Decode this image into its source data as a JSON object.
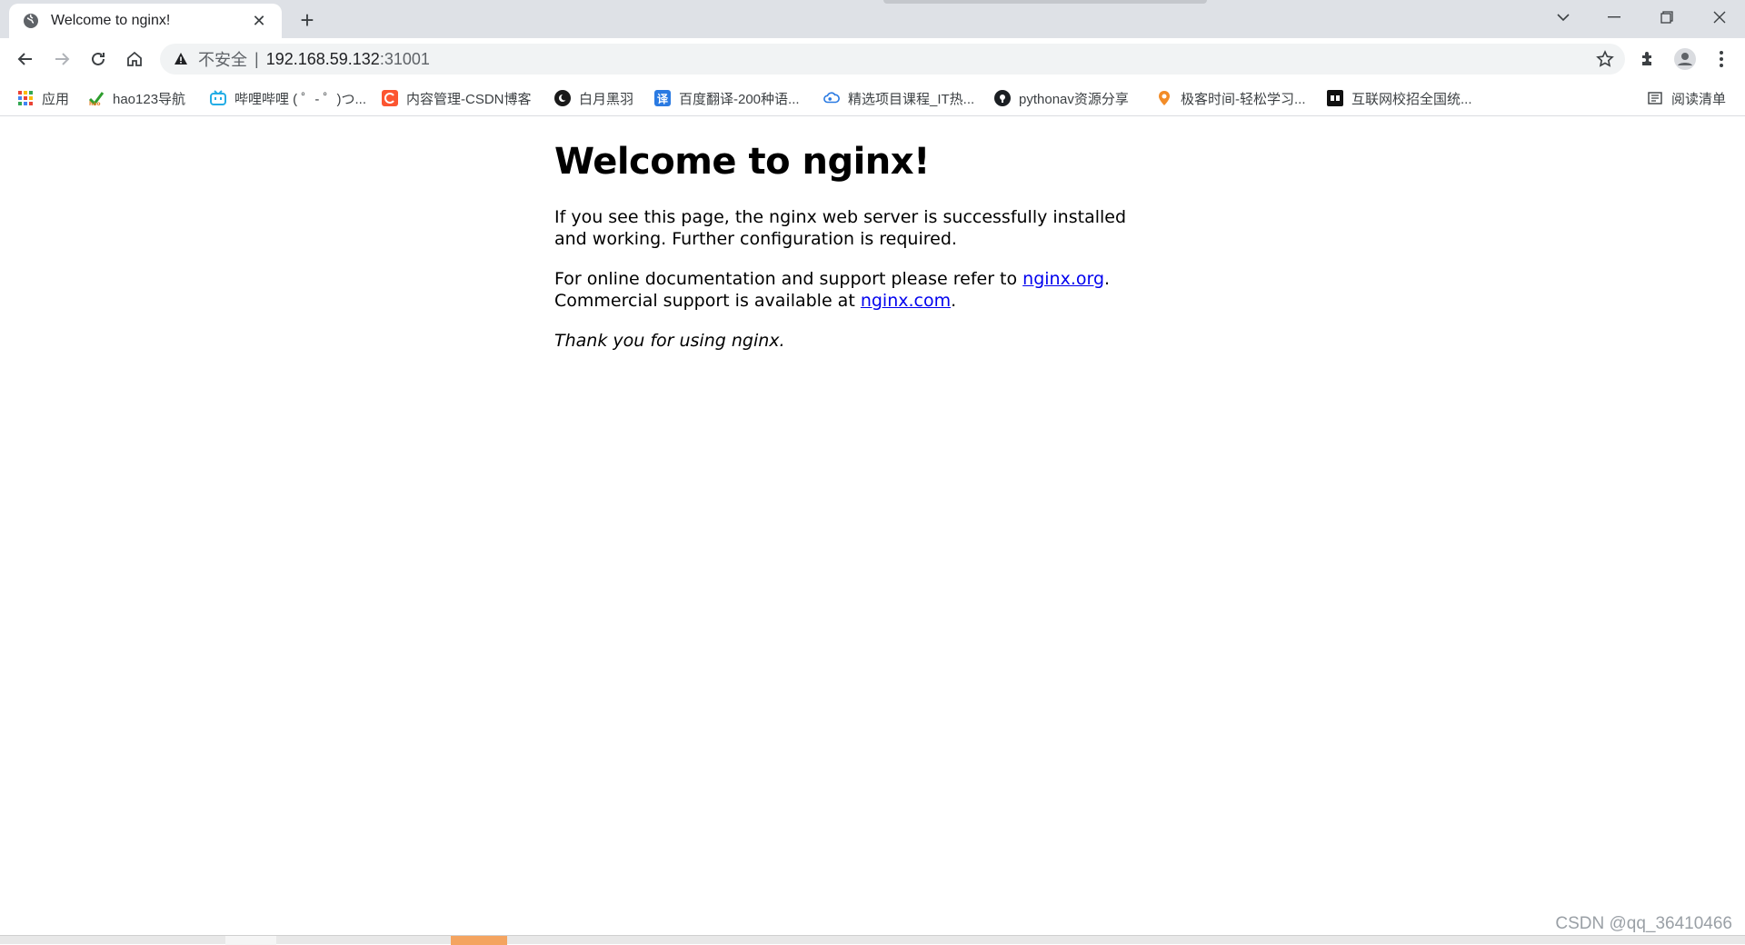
{
  "tab": {
    "title": "Welcome to nginx!",
    "close": "✕",
    "new_tab": "+"
  },
  "window_controls": {
    "dropdown": "⌄",
    "minimize": "—",
    "restore": "❐",
    "close": "✕"
  },
  "address": {
    "insecure_label": "不安全",
    "separator": "|",
    "host": "192.168.59.132",
    "port": ":31001"
  },
  "bookmarks": {
    "items": [
      {
        "label": "应用",
        "icon": "apps-grid-icon"
      },
      {
        "label": "hao123导航",
        "icon": "hao123-icon"
      },
      {
        "label": "哔哩哔哩 ( ゜- ゜)つ...",
        "icon": "bilibili-icon"
      },
      {
        "label": "内容管理-CSDN博客",
        "icon": "csdn-icon"
      },
      {
        "label": "白月黑羽",
        "icon": "baiyue-icon"
      },
      {
        "label": "百度翻译-200种语...",
        "icon": "baidu-translate-icon",
        "glyph": "译"
      },
      {
        "label": "精选项目课程_IT热...",
        "icon": "cloud-icon"
      },
      {
        "label": "pythonav资源分享",
        "icon": "github-icon"
      },
      {
        "label": "极客时间-轻松学习...",
        "icon": "geektime-icon"
      },
      {
        "label": "互联网校招全国统...",
        "icon": "nowcoder-icon"
      }
    ],
    "reading_list": "阅读清单"
  },
  "page": {
    "heading": "Welcome to nginx!",
    "p1": "If you see this page, the nginx web server is successfully installed and working. Further configuration is required.",
    "p2_a": "For online documentation and support please refer to ",
    "p2_link1": "nginx.org",
    "p2_b": ".",
    "p2_c": "Commercial support is available at ",
    "p2_link2": "nginx.com",
    "p2_d": ".",
    "p3": "Thank you for using nginx."
  },
  "watermark": "CSDN @qq_36410466",
  "colors": {
    "tab_strip": "#dee1e6",
    "link": "#0000ee",
    "omnibox": "#f1f3f4",
    "taskbar_accent": "#f4a460"
  }
}
